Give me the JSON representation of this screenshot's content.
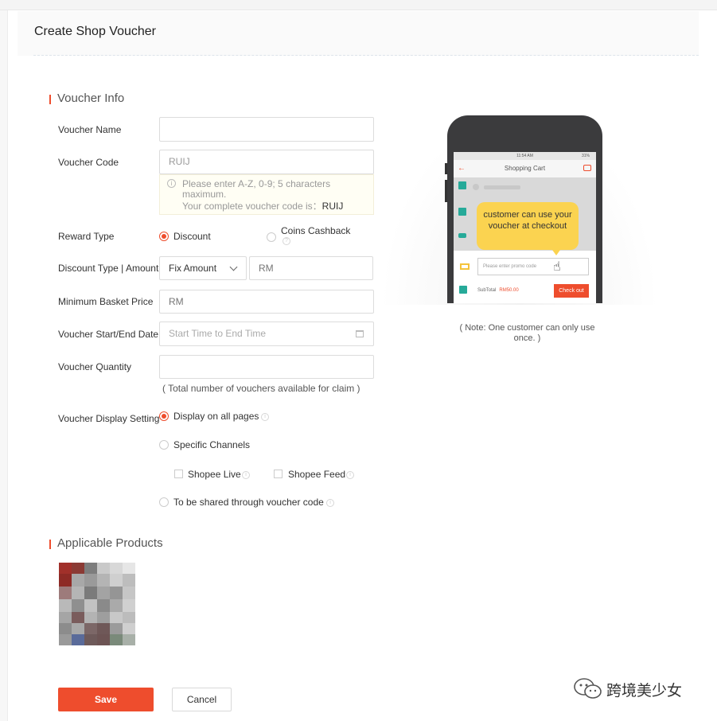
{
  "page": {
    "title": "Create Shop Voucher"
  },
  "voucher_info": {
    "section_title": "Voucher Info",
    "name": {
      "label": "Voucher Name",
      "value": ""
    },
    "code": {
      "label": "Voucher Code",
      "value": "RUIJ",
      "hint_line1": "Please enter A-Z, 0-9; 5 characters",
      "hint_line2": "maximum.",
      "hint_line3_prefix": "Your complete voucher code is：",
      "hint_line3_code": "RUIJ"
    },
    "reward_type": {
      "label": "Reward Type",
      "options": [
        "Discount",
        "Coins Cashback"
      ],
      "selected": "Discount"
    },
    "discount": {
      "label": "Discount Type | Amount",
      "type_selected": "Fix Amount",
      "amount_placeholder": "RM"
    },
    "min_basket": {
      "label": "Minimum Basket Price",
      "placeholder": "RM"
    },
    "dates": {
      "label": "Voucher Start/End Date",
      "placeholder": "Start Time to End Time"
    },
    "quantity": {
      "label": "Voucher Quantity",
      "note": "( Total number of vouchers available for claim )"
    },
    "display": {
      "label": "Voucher Display Setting",
      "option_all": "Display on all pages",
      "option_specific": "Specific Channels",
      "channel_live": "Shopee Live",
      "channel_feed": "Shopee Feed",
      "option_shared": "To be shared through voucher code",
      "selected": "Display on all pages"
    }
  },
  "applicable_products": {
    "section_title": "Applicable Products"
  },
  "preview": {
    "status_time": "11:54 AM",
    "status_battery": "31%",
    "screen_title": "Shopping Cart",
    "bubble_text": "customer can use your voucher at checkout",
    "promo_placeholder": "Please enter promo code",
    "subtotal_label": "SubTotal",
    "subtotal_value": "RM50.00",
    "checkout_label": "Check out",
    "note": "( Note: One customer can only use once. )"
  },
  "actions": {
    "save_label": "Save",
    "cancel_label": "Cancel"
  },
  "watermark": {
    "text": "跨境美少女"
  },
  "colors": {
    "accent": "#ee4d2d",
    "bubble": "#fbd350",
    "checkbox_teal": "#26aa99"
  }
}
